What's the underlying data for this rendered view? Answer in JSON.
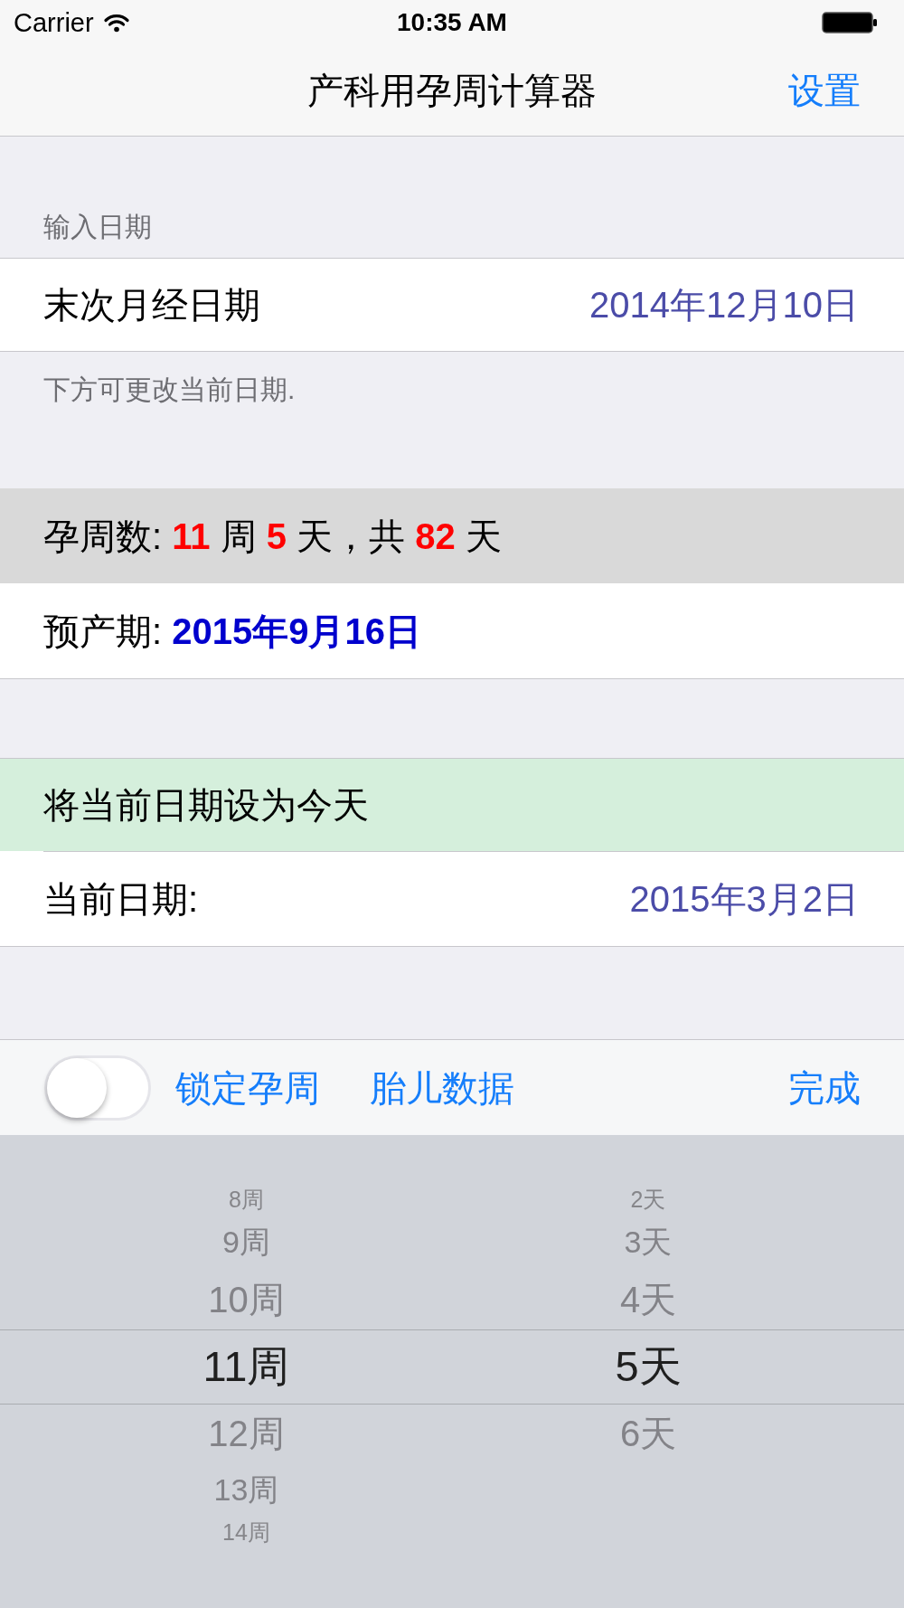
{
  "status_bar": {
    "carrier": "Carrier",
    "time": "10:35 AM"
  },
  "nav_bar": {
    "title": "产科用孕周计算器",
    "settings_button": "设置"
  },
  "input_section": {
    "header": "输入日期",
    "rows": [
      {
        "label": "末次月经日期",
        "value": "2014年12月10日"
      }
    ],
    "footer": "下方可更改当前日期."
  },
  "results": [
    {
      "kind": "gestation",
      "segments": [
        {
          "kind": "label",
          "text": "孕周数:"
        },
        {
          "kind": "number",
          "text": "11"
        },
        {
          "kind": "text",
          "text": "周"
        },
        {
          "kind": "number",
          "text": "5"
        },
        {
          "kind": "text",
          "text": "天，共"
        },
        {
          "kind": "number",
          "text": "82"
        },
        {
          "kind": "text",
          "text": "天"
        }
      ]
    },
    {
      "kind": "due_date",
      "segments": [
        {
          "kind": "label",
          "text": "预产期:"
        },
        {
          "kind": "date",
          "text": "2015年9月16日"
        }
      ]
    }
  ],
  "today_button": "将当前日期设为今天",
  "current_date": {
    "label": "当前日期:",
    "value": "2015年3月2日"
  },
  "toolbar": {
    "lock_switch": {
      "on": false,
      "label": "锁定孕周"
    },
    "fetal_data_button": "胎儿数据",
    "done_button": "完成"
  },
  "picker": {
    "columns": [
      {
        "items": [
          {
            "text": "8周",
            "selected": false
          },
          {
            "text": "9周",
            "selected": false
          },
          {
            "text": "10周",
            "selected": false
          },
          {
            "text": "11周",
            "selected": true
          },
          {
            "text": "12周",
            "selected": false
          },
          {
            "text": "13周",
            "selected": false
          },
          {
            "text": "14周",
            "selected": false
          }
        ]
      },
      {
        "items": [
          {
            "text": "2天",
            "selected": false
          },
          {
            "text": "3天",
            "selected": false
          },
          {
            "text": "4天",
            "selected": false
          },
          {
            "text": "5天",
            "selected": true
          },
          {
            "text": "6天",
            "selected": false
          }
        ]
      }
    ]
  }
}
